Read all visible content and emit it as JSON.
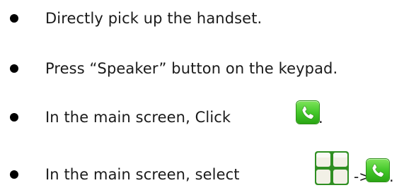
{
  "items": [
    {
      "text": "Directly pick up the handset."
    },
    {
      "text": "Press “Speaker” button on the keypad."
    },
    {
      "text": "In the main screen, Click",
      "icon": "phone-call-icon",
      "trailing": "."
    },
    {
      "text": "In the main screen, select",
      "icons": [
        "menu-grid-icon",
        "phone-call-icon"
      ],
      "separator": "->",
      "trailing": "."
    }
  ],
  "colors": {
    "bullet": "#000000",
    "text": "#1a1a1a",
    "phone_icon_green": "#44c82a",
    "menu_icon_green": "#4db33a"
  }
}
